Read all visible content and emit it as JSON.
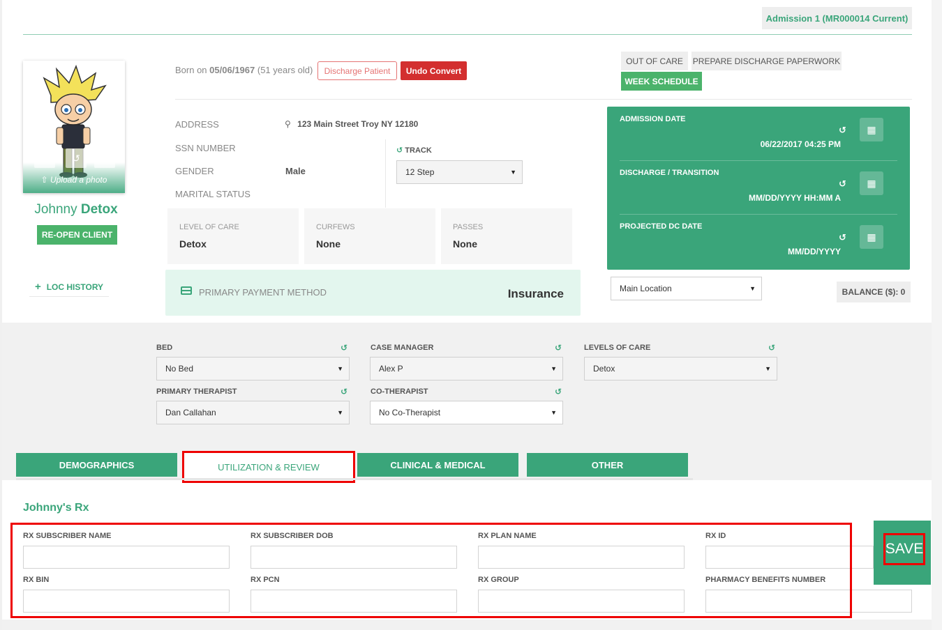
{
  "header": {
    "admission": "Admission 1 (MR000014 Current)"
  },
  "client": {
    "upload_label": "Upload a photo",
    "first_name": "Johnny",
    "last_name": "Detox",
    "reopen_label": "RE-OPEN CLIENT",
    "loc_history_label": "LOC HISTORY",
    "born_prefix": "Born on",
    "born_date": "05/06/1967",
    "born_age": "(51 years old)"
  },
  "actions": {
    "discharge_patient": "Discharge Patient",
    "undo_convert": "Undo Convert",
    "out_of_care": "OUT OF CARE",
    "prepare_discharge": "PREPARE DISCHARGE PAPERWORK",
    "week_schedule": "WEEK SCHEDULE"
  },
  "info": {
    "address_label": "ADDRESS",
    "address_value": "123 Main Street Troy NY 12180",
    "ssn_label": "SSN NUMBER",
    "gender_label": "GENDER",
    "gender_value": "Male",
    "marital_label": "MARITAL STATUS",
    "track_label": "TRACK",
    "track_value": "12 Step"
  },
  "cards": [
    {
      "label": "LEVEL OF CARE",
      "value": "Detox"
    },
    {
      "label": "CURFEWS",
      "value": "None"
    },
    {
      "label": "PASSES",
      "value": "None"
    }
  ],
  "payment": {
    "label": "PRIMARY PAYMENT METHOD",
    "value": "Insurance"
  },
  "dates": [
    {
      "label": "ADMISSION DATE",
      "value": "06/22/2017 04:25 PM"
    },
    {
      "label": "DISCHARGE / TRANSITION",
      "value": "MM/DD/YYYY HH:MM A"
    },
    {
      "label": "PROJECTED DC DATE",
      "value": "MM/DD/YYYY"
    }
  ],
  "location": {
    "value": "Main Location"
  },
  "balance": "BALANCE ($): 0",
  "assignments": {
    "bed_label": "BED",
    "bed_value": "No Bed",
    "case_manager_label": "CASE MANAGER",
    "case_manager_value": "Alex P",
    "levels_label": "LEVELS OF CARE",
    "levels_value": "Detox",
    "therapist_label": "PRIMARY THERAPIST",
    "therapist_value": "Dan Callahan",
    "cotherapist_label": "CO-THERAPIST",
    "cotherapist_value": "No Co-Therapist"
  },
  "tabs": [
    {
      "label": "DEMOGRAPHICS"
    },
    {
      "label": "UTILIZATION & REVIEW"
    },
    {
      "label": "CLINICAL & MEDICAL"
    },
    {
      "label": "OTHER"
    }
  ],
  "rx": {
    "title": "Johnny's Rx",
    "fields": [
      {
        "label": "RX SUBSCRIBER NAME",
        "value": ""
      },
      {
        "label": "RX SUBSCRIBER DOB",
        "value": ""
      },
      {
        "label": "RX PLAN NAME",
        "value": ""
      },
      {
        "label": "RX ID",
        "value": ""
      },
      {
        "label": "RX BIN",
        "value": ""
      },
      {
        "label": "RX PCN",
        "value": ""
      },
      {
        "label": "RX GROUP",
        "value": ""
      },
      {
        "label": "PHARMACY BENEFITS NUMBER",
        "value": ""
      }
    ],
    "save_label": "SAVE"
  },
  "colors": {
    "brand_green": "#3aa57a",
    "button_green": "#4bb36b",
    "danger_red": "#d32f2f",
    "highlight_red": "#e00000"
  }
}
